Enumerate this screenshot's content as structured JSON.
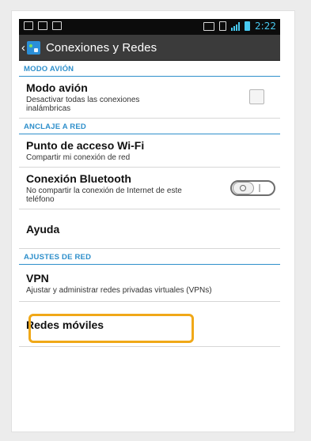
{
  "status_bar": {
    "time": "2:22"
  },
  "action_bar": {
    "title": "Conexiones y Redes"
  },
  "sections": {
    "airplane": "MODO AVIÓN",
    "tether": "ANCLAJE A RED",
    "network": "AJUSTES DE RED"
  },
  "items": {
    "airplane_mode": {
      "title": "Modo avión",
      "subtitle": "Desactivar todas las conexiones inalámbricas",
      "checked": false
    },
    "wifi_hotspot": {
      "title": "Punto de acceso Wi-Fi",
      "subtitle": "Compartir mi conexión de red"
    },
    "bluetooth_tether": {
      "title": "Conexión Bluetooth",
      "subtitle": "No compartir la conexión de Internet de este teléfono",
      "enabled": false
    },
    "help": {
      "title": "Ayuda"
    },
    "vpn": {
      "title": "VPN",
      "subtitle": "Ajustar y administrar redes privadas virtuales (VPNs)"
    },
    "mobile_networks": {
      "title": "Redes móviles"
    }
  },
  "colors": {
    "accent": "#2e8fcb",
    "highlight": "#f0a818",
    "status_accent": "#48c9f0"
  }
}
